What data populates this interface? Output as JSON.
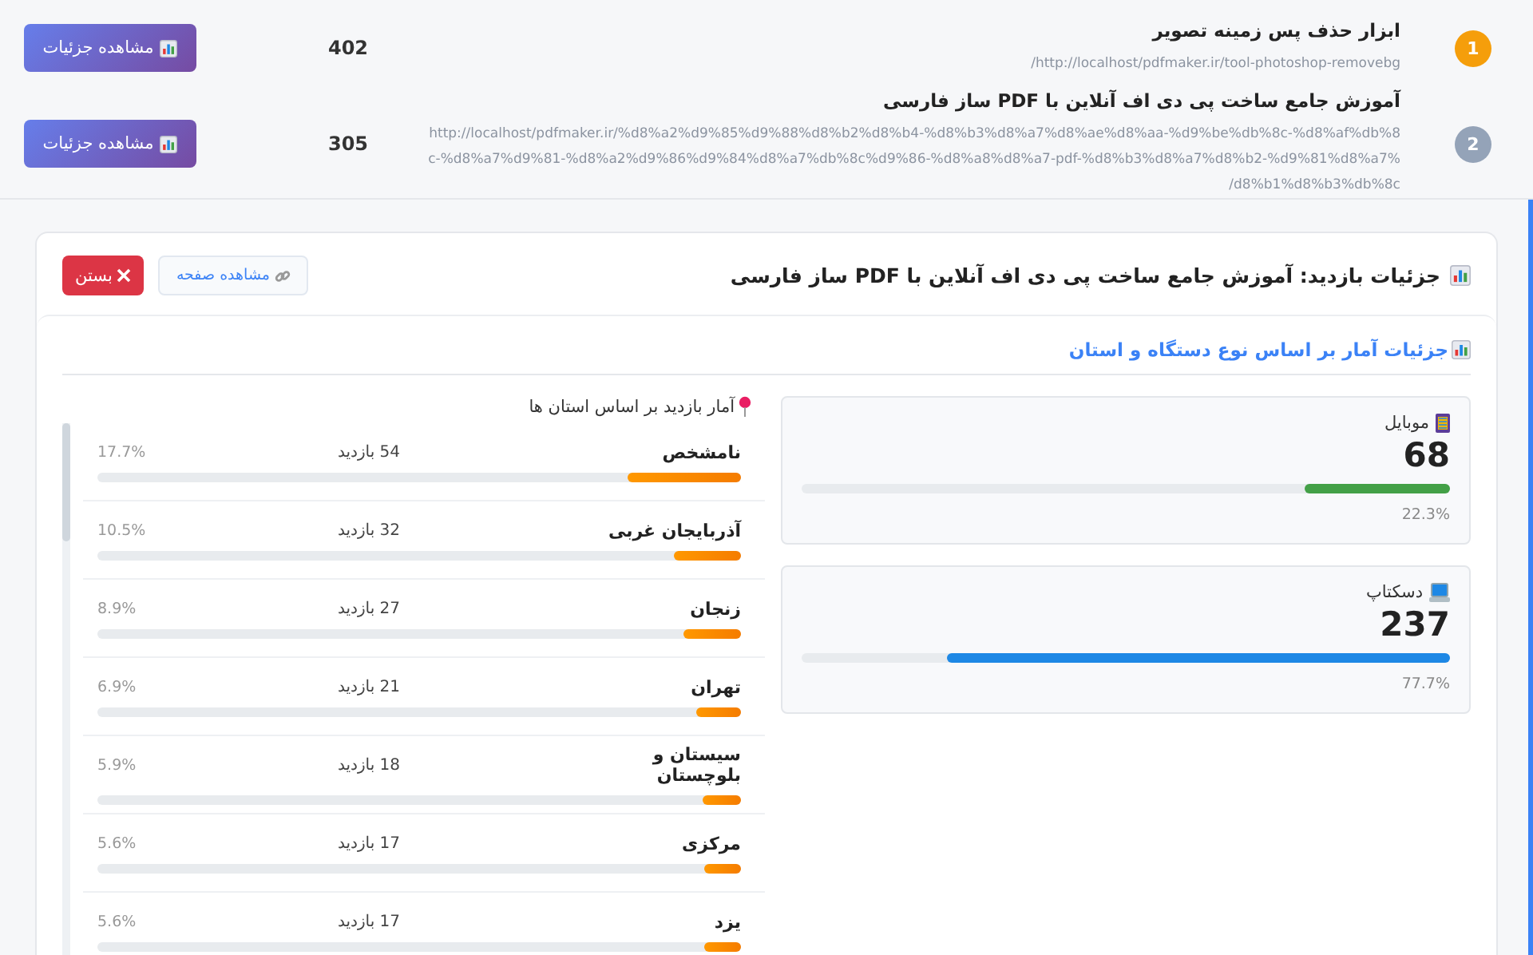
{
  "pages": [
    {
      "rank": "1",
      "color": "#f59e0b",
      "title": "ابزار حذف پس زمینه تصویر",
      "url": "http://localhost/pdfmaker.ir/tool-photoshop-removebg/",
      "visits": "402",
      "button": "مشاهده جزئیات"
    },
    {
      "rank": "2",
      "color": "#94a3b8",
      "title": "آموزش جامع ساخت پی دی اف آنلاین با PDF ساز فارسی",
      "url": "http://localhost/pdfmaker.ir/%d8%a2%d9%85%d9%88%d8%b2%d8%b4-%d8%b3%d8%a7%d8%ae%d8%aa-%d9%be%db%8c-%d8%af%db%8c-%d8%a7%d9%81-%d8%a2%d9%86%d9%84%d8%a7%db%8c%d9%86-%d8%a8%d8%a7-pdf-%d8%b3%d8%a7%d8%b2-%d9%81%d8%a7%d8%b1%d8%b3%db%8c/",
      "visits": "305",
      "button": "مشاهده جزئیات"
    }
  ],
  "detail": {
    "title": "جزئیات بازدید: آموزش جامع ساخت پی دی اف آنلاین با PDF ساز فارسی",
    "view_button": "مشاهده صفحه",
    "close_button": "بستن",
    "section_title": "جزئیات آمار بر اساس نوع دستگاه و استان",
    "provinces_title": "آمار بازدید بر اساس استان ها",
    "provinces": [
      {
        "name": "نامشخص",
        "visits": "54 بازدید",
        "percent": "17.7%",
        "level": 0.177
      },
      {
        "name": "آذربایجان غربی",
        "visits": "32 بازدید",
        "percent": "10.5%",
        "level": 0.105
      },
      {
        "name": "زنجان",
        "visits": "27 بازدید",
        "percent": "8.9%",
        "level": 0.089
      },
      {
        "name": "تهران",
        "visits": "21 بازدید",
        "percent": "6.9%",
        "level": 0.069
      },
      {
        "name": "سیستان و بلوچستان",
        "visits": "18 بازدید",
        "percent": "5.9%",
        "level": 0.059
      },
      {
        "name": "مرکزی",
        "visits": "17 بازدید",
        "percent": "5.6%",
        "level": 0.056
      },
      {
        "name": "یزد",
        "visits": "17 بازدید",
        "percent": "5.6%",
        "level": 0.056
      }
    ],
    "devices": [
      {
        "kind": "mobile",
        "label": "موبایل",
        "count": "68",
        "percent": "22.3%",
        "level": 0.223,
        "color": "#43a047"
      },
      {
        "kind": "desktop",
        "label": "دسکتاپ",
        "count": "237",
        "percent": "77.7%",
        "level": 0.777,
        "color": "#1e88e5"
      }
    ]
  }
}
